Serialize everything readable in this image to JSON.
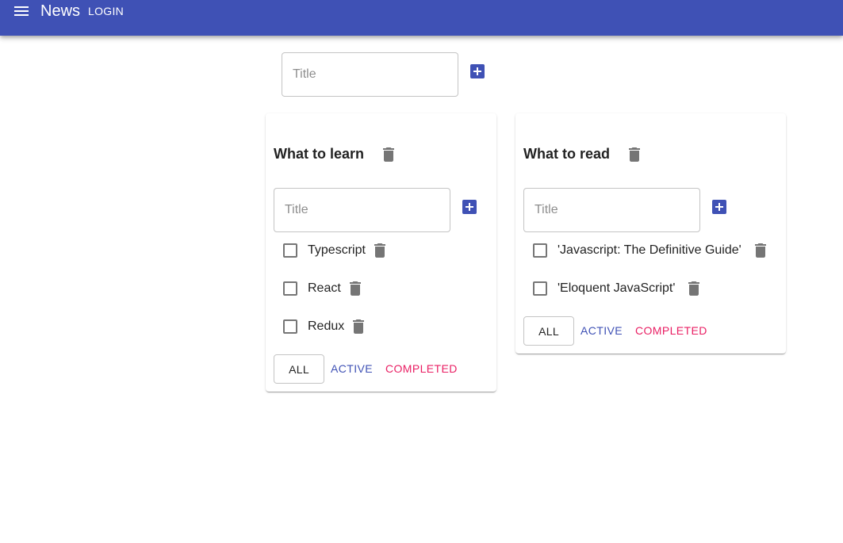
{
  "appbar": {
    "menu_icon": "menu-icon",
    "title": "News",
    "login_label": "LOGIN"
  },
  "new_list": {
    "placeholder": "Title",
    "add_icon": "add-box-icon"
  },
  "lists": [
    {
      "title": "What to learn",
      "input_placeholder": "Title",
      "tasks": [
        {
          "label": "Typescript",
          "checked": false
        },
        {
          "label": "React",
          "checked": false
        },
        {
          "label": "Redux",
          "checked": false
        }
      ],
      "filters": {
        "all": "ALL",
        "active": "ACTIVE",
        "completed": "COMPLETED"
      }
    },
    {
      "title": "What to read",
      "input_placeholder": "Title",
      "tasks": [
        {
          "label": "'Javascript: The Definitive Guide'",
          "checked": false
        },
        {
          "label": "'Eloquent JavaScript'",
          "checked": false
        }
      ],
      "filters": {
        "all": "ALL",
        "active": "ACTIVE",
        "completed": "COMPLETED"
      }
    }
  ],
  "colors": {
    "primary": "#3f51b5",
    "secondary": "#e91e63",
    "icon_grey": "#757575"
  },
  "icons": {
    "delete": "delete-icon",
    "add": "add-box-icon",
    "checkbox": "checkbox-outline-icon"
  }
}
